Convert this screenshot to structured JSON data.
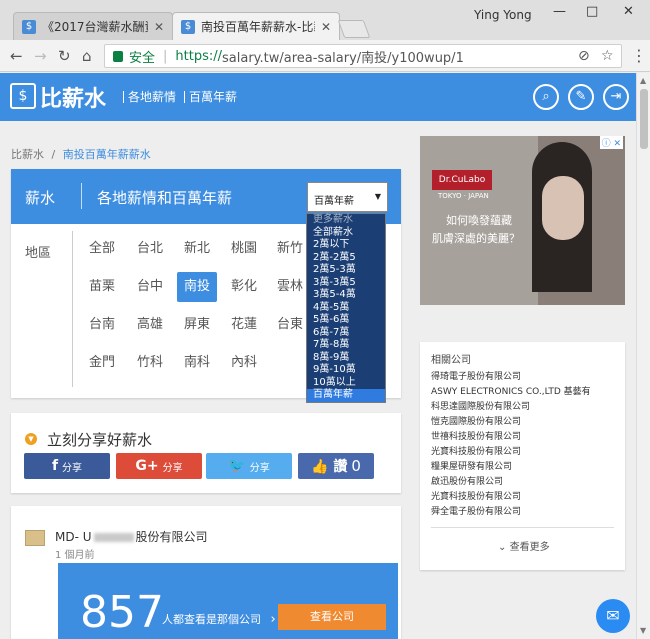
{
  "browser": {
    "tabs": [
      {
        "label": "《2017台灣薪水酬資查詢",
        "favicon": "$"
      },
      {
        "label": "南投百萬年薪薪水-比薪水",
        "favicon": "$"
      }
    ],
    "user": "Ying Yong",
    "window_controls": {
      "minimize": "—",
      "maximize": "□",
      "close": "✕"
    },
    "security_label": "安全",
    "url_scheme": "https://",
    "url_rest": "salary.tw/area-salary/南投/y100wup/1"
  },
  "site": {
    "logo_icon": "$",
    "logo_text": "比薪水",
    "nav": [
      "各地薪情",
      "百萬年薪"
    ],
    "header_icons": [
      "search-icon",
      "edit-icon",
      "login-icon"
    ]
  },
  "breadcrumb": {
    "home": "比薪水",
    "separator": "/",
    "current": "南投百萬年薪薪水"
  },
  "salary_panel": {
    "title": "薪水",
    "subtitle": "各地薪情和百萬年薪",
    "select_value": "百萬年薪",
    "region_label": "地區",
    "cities": [
      [
        "全部",
        "台北",
        "新北",
        "桃園",
        "新竹"
      ],
      [
        "苗栗",
        "台中",
        "南投",
        "彰化",
        "雲林"
      ],
      [
        "台南",
        "高雄",
        "屏東",
        "花蓮",
        "台東"
      ],
      [
        "金門",
        "竹科",
        "南科",
        "內科"
      ]
    ],
    "active_city": "南投",
    "dropdown_options": [
      "更多薪水",
      "全部薪水",
      "2萬以下",
      "2萬-2萬5",
      "2萬5-3萬",
      "3萬-3萬5",
      "3萬5-4萬",
      "4萬-5萬",
      "5萬-6萬",
      "6萬-7萬",
      "7萬-8萬",
      "8萬-9萬",
      "9萬-10萬",
      "10萬以上",
      "百萬年薪"
    ]
  },
  "share": {
    "title": "立刻分享好薪水",
    "buttons": [
      {
        "icon": "f",
        "label": "分享",
        "color": "#3a5a99"
      },
      {
        "icon": "G+",
        "label": "分享",
        "color": "#dd4b39"
      },
      {
        "icon": "🐦",
        "label": "分享",
        "color": "#55acee"
      },
      {
        "icon": "👍 讚",
        "label": "0",
        "color": "#4a69ad"
      }
    ]
  },
  "company_card": {
    "name_prefix": "MD- U",
    "name_suffix": "股份有限公司",
    "time": "1 個月前",
    "count": "857",
    "count_text": "人都查看是那個公司",
    "button": "查看公司"
  },
  "ad": {
    "brand": "Dr.CuLabo",
    "brand_sub": "TOKYO · JAPAN",
    "line1": "如何喚發蘊藏",
    "line2": "肌膚深處的美麗？"
  },
  "related": {
    "title": "相關公司",
    "items": [
      "得琦電子股份有限公司",
      "ASWY ELECTRONICS CO.,LTD 基藝有",
      "科思達國際股份有限公司",
      "愷克國際股份有限公司",
      "世禧科技股份有限公司",
      "光寶科技股份有限公司",
      "糧果屋研發有限公司",
      "啟迅股份有限公司",
      "光寶科技股份有限公司",
      "舜全電子股份有限公司"
    ],
    "more": "查看更多"
  },
  "colors": {
    "brand_blue": "#3d8de0",
    "accent_orange": "#f08a30"
  }
}
